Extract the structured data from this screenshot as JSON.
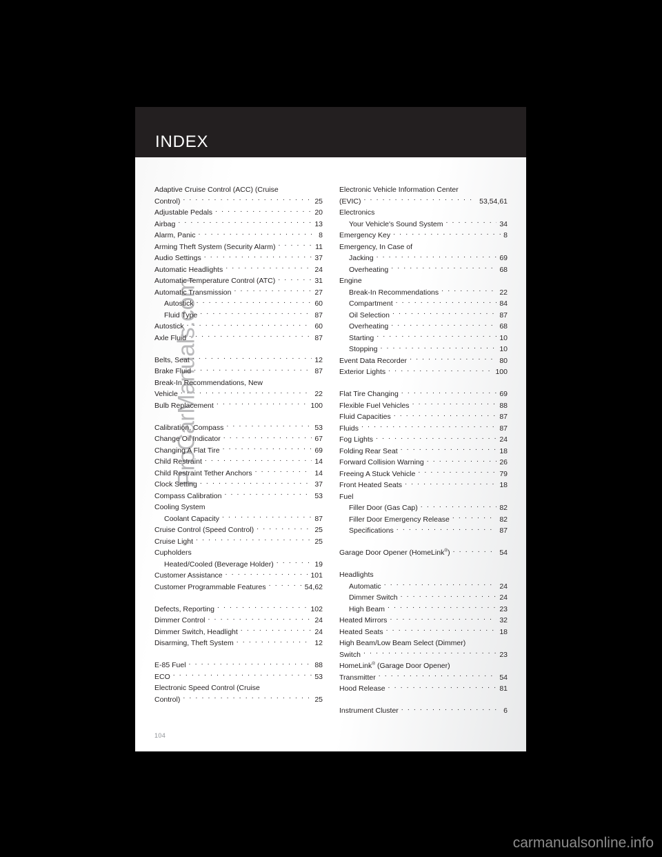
{
  "header": {
    "title": "INDEX"
  },
  "page_number": "104",
  "watermark": "ProCarManuals.com",
  "site_footer": "carmanualsonline.info",
  "index": {
    "left_column": [
      {
        "label": "Adaptive Cruise Control (ACC) (Cruise",
        "page": "",
        "kind": "wrap"
      },
      {
        "label": "Control)",
        "page": "25",
        "kind": "main"
      },
      {
        "label": "Adjustable Pedals",
        "page": "20",
        "kind": "main"
      },
      {
        "label": "Airbag",
        "page": "13",
        "kind": "main"
      },
      {
        "label": "Alarm, Panic",
        "page": "8",
        "kind": "main"
      },
      {
        "label": "Arming Theft System (Security Alarm)",
        "page": "11",
        "kind": "main"
      },
      {
        "label": "Audio Settings",
        "page": "37",
        "kind": "main"
      },
      {
        "label": "Automatic Headlights",
        "page": "24",
        "kind": "main"
      },
      {
        "label": "Automatic Temperature Control (ATC)",
        "page": "31",
        "kind": "main"
      },
      {
        "label": "Automatic Transmission",
        "page": "27",
        "kind": "main"
      },
      {
        "label": "Autostick",
        "page": "60",
        "kind": "sub"
      },
      {
        "label": "Fluid Type",
        "page": "87",
        "kind": "sub"
      },
      {
        "label": "Autostick",
        "page": "60",
        "kind": "main"
      },
      {
        "label": "Axle Fluid",
        "page": "87",
        "kind": "main"
      },
      {
        "label": "",
        "page": "",
        "kind": "gap"
      },
      {
        "label": "Belts, Seat",
        "page": "12",
        "kind": "main"
      },
      {
        "label": "Brake Fluid",
        "page": "87",
        "kind": "main"
      },
      {
        "label": "Break-In Recommendations, New",
        "page": "",
        "kind": "wrap"
      },
      {
        "label": "Vehicle",
        "page": "22",
        "kind": "main"
      },
      {
        "label": "Bulb Replacement",
        "page": "100",
        "kind": "main"
      },
      {
        "label": "",
        "page": "",
        "kind": "gap"
      },
      {
        "label": "Calibration, Compass",
        "page": "53",
        "kind": "main"
      },
      {
        "label": "Change Oil Indicator",
        "page": "67",
        "kind": "main"
      },
      {
        "label": "Changing A Flat Tire",
        "page": "69",
        "kind": "main"
      },
      {
        "label": "Child Restraint",
        "page": "14",
        "kind": "main"
      },
      {
        "label": "Child Restraint Tether Anchors",
        "page": "14",
        "kind": "main"
      },
      {
        "label": "Clock Setting",
        "page": "37",
        "kind": "main"
      },
      {
        "label": "Compass Calibration",
        "page": "53",
        "kind": "main"
      },
      {
        "label": "Cooling System",
        "page": "",
        "kind": "wrap"
      },
      {
        "label": "Coolant Capacity",
        "page": "87",
        "kind": "sub"
      },
      {
        "label": "Cruise Control (Speed Control)",
        "page": "25",
        "kind": "main"
      },
      {
        "label": "Cruise Light",
        "page": "25",
        "kind": "main"
      },
      {
        "label": "Cupholders",
        "page": "",
        "kind": "wrap"
      },
      {
        "label": "Heated/Cooled (Beverage Holder)",
        "page": "19",
        "kind": "sub"
      },
      {
        "label": "Customer Assistance",
        "page": "101",
        "kind": "main"
      },
      {
        "label": "Customer Programmable Features",
        "page": "54,62",
        "kind": "main"
      },
      {
        "label": "",
        "page": "",
        "kind": "gap"
      },
      {
        "label": "Defects, Reporting",
        "page": "102",
        "kind": "main"
      },
      {
        "label": "Dimmer Control",
        "page": "24",
        "kind": "main"
      },
      {
        "label": "Dimmer Switch, Headlight",
        "page": "24",
        "kind": "main"
      },
      {
        "label": "Disarming, Theft System",
        "page": "12",
        "kind": "main"
      },
      {
        "label": "",
        "page": "",
        "kind": "gap"
      },
      {
        "label": "E-85 Fuel",
        "page": "88",
        "kind": "main"
      },
      {
        "label": "ECO",
        "page": "53",
        "kind": "main"
      },
      {
        "label": "Electronic Speed Control (Cruise",
        "page": "",
        "kind": "wrap"
      },
      {
        "label": "Control)",
        "page": "25",
        "kind": "main"
      }
    ],
    "right_column": [
      {
        "label": "Electronic Vehicle Information Center",
        "page": "",
        "kind": "wrap"
      },
      {
        "label": "(EVIC)",
        "page": "53,54,61",
        "kind": "main"
      },
      {
        "label": "Electronics",
        "page": "",
        "kind": "wrap"
      },
      {
        "label": "Your Vehicle's Sound System",
        "page": "34",
        "kind": "sub"
      },
      {
        "label": "Emergency Key",
        "page": "8",
        "kind": "main"
      },
      {
        "label": "Emergency, In Case of",
        "page": "",
        "kind": "wrap"
      },
      {
        "label": "Jacking",
        "page": "69",
        "kind": "sub"
      },
      {
        "label": "Overheating",
        "page": "68",
        "kind": "sub"
      },
      {
        "label": "Engine",
        "page": "",
        "kind": "wrap"
      },
      {
        "label": "Break-In Recommendations",
        "page": "22",
        "kind": "sub"
      },
      {
        "label": "Compartment",
        "page": "84",
        "kind": "sub"
      },
      {
        "label": "Oil Selection",
        "page": "87",
        "kind": "sub"
      },
      {
        "label": "Overheating",
        "page": "68",
        "kind": "sub"
      },
      {
        "label": "Starting",
        "page": "10",
        "kind": "sub"
      },
      {
        "label": "Stopping",
        "page": "10",
        "kind": "sub"
      },
      {
        "label": "Event Data Recorder",
        "page": "80",
        "kind": "main"
      },
      {
        "label": "Exterior Lights",
        "page": "100",
        "kind": "main"
      },
      {
        "label": "",
        "page": "",
        "kind": "gap"
      },
      {
        "label": "Flat Tire Changing",
        "page": "69",
        "kind": "main"
      },
      {
        "label": "Flexible Fuel Vehicles",
        "page": "88",
        "kind": "main"
      },
      {
        "label": "Fluid Capacities",
        "page": "87",
        "kind": "main"
      },
      {
        "label": "Fluids",
        "page": "87",
        "kind": "main"
      },
      {
        "label": "Fog Lights",
        "page": "24",
        "kind": "main"
      },
      {
        "label": "Folding Rear Seat",
        "page": "18",
        "kind": "main"
      },
      {
        "label": "Forward Collision Warning",
        "page": "26",
        "kind": "main"
      },
      {
        "label": "Freeing A Stuck Vehicle",
        "page": "79",
        "kind": "main"
      },
      {
        "label": "Front Heated Seats",
        "page": "18",
        "kind": "main"
      },
      {
        "label": "Fuel",
        "page": "",
        "kind": "wrap"
      },
      {
        "label": "Filler Door (Gas Cap)",
        "page": "82",
        "kind": "sub"
      },
      {
        "label": "Filler Door Emergency Release",
        "page": "82",
        "kind": "sub"
      },
      {
        "label": "Specifications",
        "page": "87",
        "kind": "sub"
      },
      {
        "label": "",
        "page": "",
        "kind": "gap"
      },
      {
        "label": "Garage Door Opener (HomeLink®)",
        "page": "54",
        "kind": "main"
      },
      {
        "label": "",
        "page": "",
        "kind": "gap"
      },
      {
        "label": "Headlights",
        "page": "",
        "kind": "wrap"
      },
      {
        "label": "Automatic",
        "page": "24",
        "kind": "sub"
      },
      {
        "label": "Dimmer Switch",
        "page": "24",
        "kind": "sub"
      },
      {
        "label": "High Beam",
        "page": "23",
        "kind": "sub"
      },
      {
        "label": "Heated Mirrors",
        "page": "32",
        "kind": "main"
      },
      {
        "label": "Heated Seats",
        "page": "18",
        "kind": "main"
      },
      {
        "label": "High Beam/Low Beam Select (Dimmer)",
        "page": "",
        "kind": "wrap"
      },
      {
        "label": "Switch",
        "page": "23",
        "kind": "main"
      },
      {
        "label": "HomeLink® (Garage Door Opener)",
        "page": "",
        "kind": "wrap"
      },
      {
        "label": "Transmitter",
        "page": "54",
        "kind": "main"
      },
      {
        "label": "Hood Release",
        "page": "81",
        "kind": "main"
      },
      {
        "label": "",
        "page": "",
        "kind": "gap"
      },
      {
        "label": "Instrument Cluster",
        "page": "6",
        "kind": "main"
      }
    ]
  }
}
